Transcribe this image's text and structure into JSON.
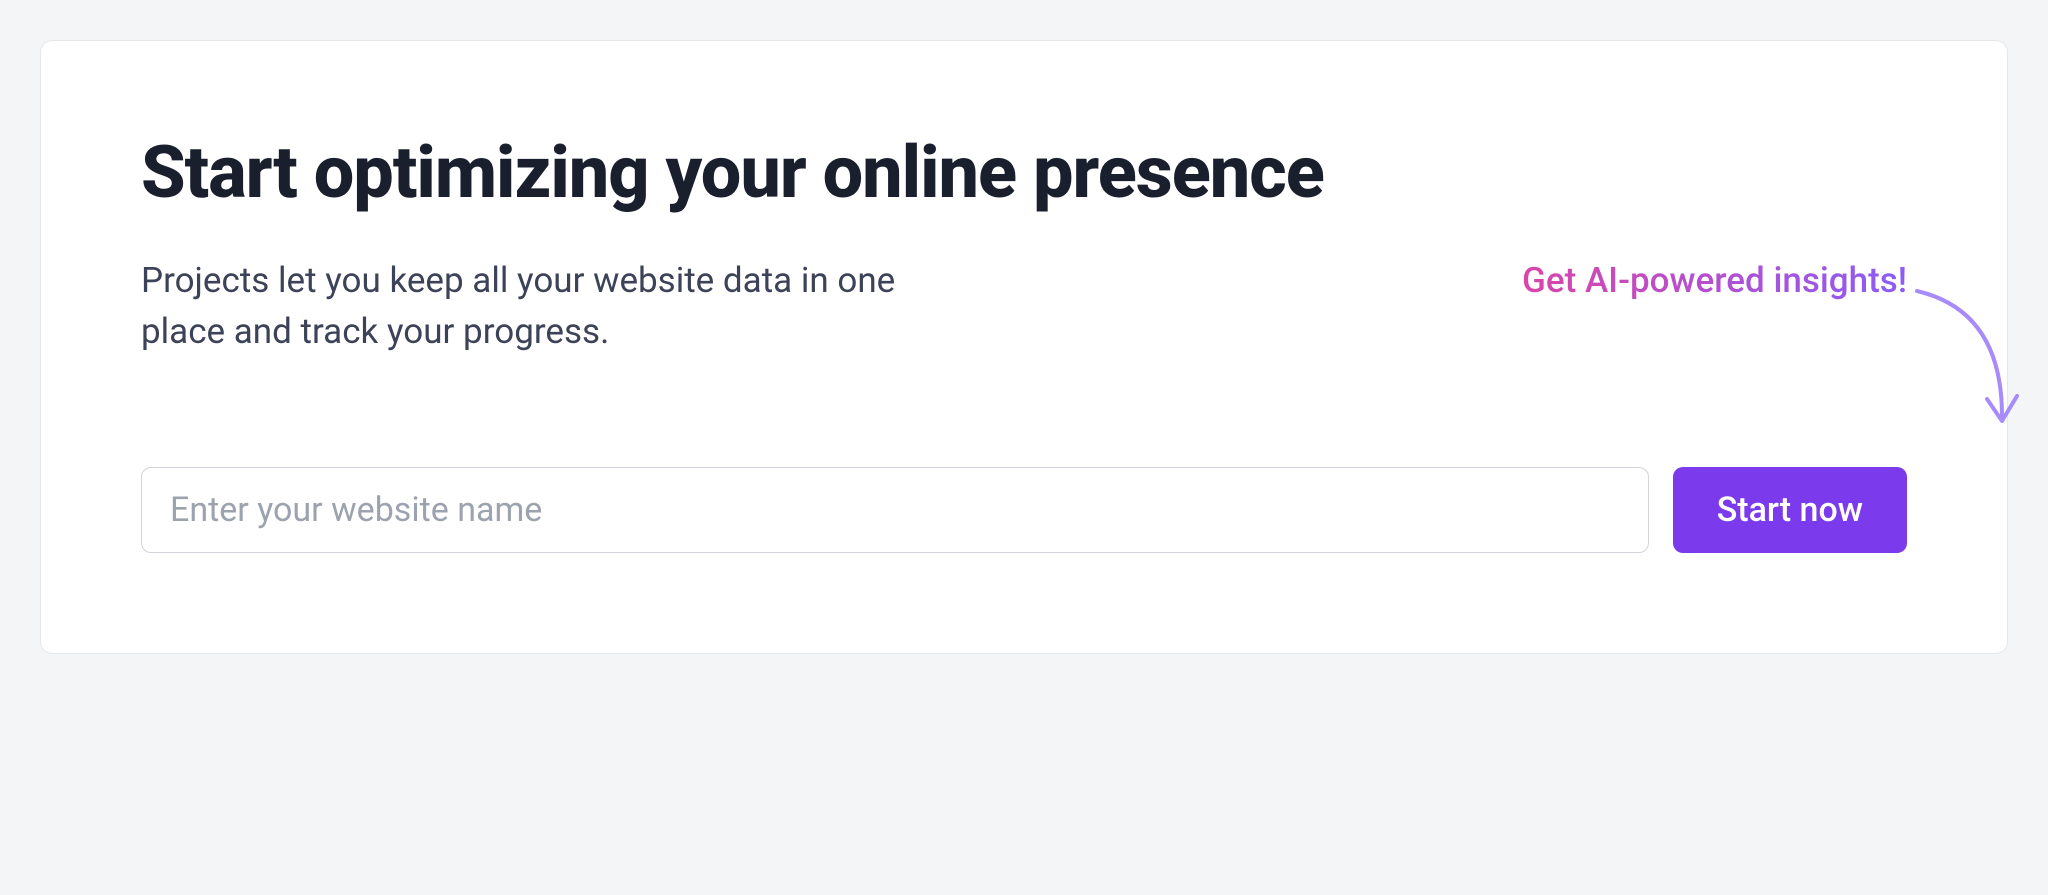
{
  "hero": {
    "heading": "Start optimizing your online presence",
    "subtitle": "Projects let you keep all your website data in one place and track your progress.",
    "callout": "Get AI-powered insights!"
  },
  "form": {
    "website_placeholder": "Enter your website name",
    "start_button_label": "Start now"
  },
  "colors": {
    "accent": "#7c3aed",
    "gradient_start": "#D946A9",
    "gradient_end": "#8B5CF6"
  }
}
